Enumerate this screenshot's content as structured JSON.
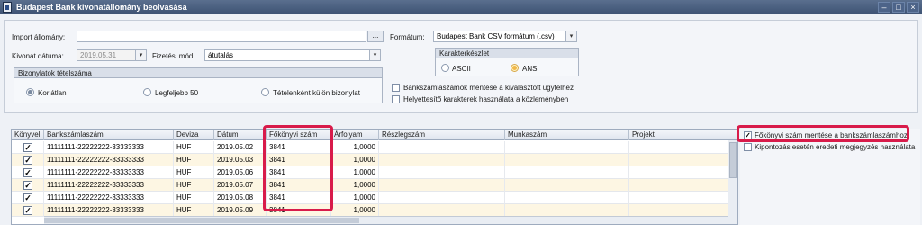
{
  "window": {
    "title": "Budapest Bank kivonatállomány beolvasása"
  },
  "form": {
    "import_label": "Import állomány:",
    "import_value": "",
    "browse_label": "...",
    "date_label": "Kivonat dátuma:",
    "date_value": "2019.05.31",
    "payment_label": "Fizetési mód:",
    "payment_value": "átutalás",
    "format_label": "Formátum:",
    "format_value": "Budapest Bank CSV formátum (.csv)"
  },
  "count_group": {
    "title": "Bizonylatok tételszáma",
    "options": [
      "Korlátlan",
      "Legfeljebb 50",
      "Tételenként külön bizonylat"
    ],
    "selected": 0
  },
  "charset_group": {
    "title": "Karakterkészlet",
    "options": [
      "ASCII",
      "ANSI"
    ],
    "selected": 1
  },
  "checks": {
    "save_accounts": "Bankszámlaszámok mentése a kiválasztott ügyfélhez",
    "replacement_chars": "Helyettesítő karakterek használata a közleményben"
  },
  "grid": {
    "columns": [
      "Könyvel",
      "Bankszámlaszám",
      "Deviza",
      "Dátum",
      "Főkönyvi szám",
      "Árfolyam",
      "Részlegszám",
      "Munkaszám",
      "Projekt"
    ],
    "rows": [
      {
        "checked": true,
        "account": "11111111-22222222-33333333",
        "currency": "HUF",
        "date": "2019.05.02",
        "ledger": "3841",
        "rate": "1,0000"
      },
      {
        "checked": true,
        "account": "11111111-22222222-33333333",
        "currency": "HUF",
        "date": "2019.05.03",
        "ledger": "3841",
        "rate": "1,0000"
      },
      {
        "checked": true,
        "account": "11111111-22222222-33333333",
        "currency": "HUF",
        "date": "2019.05.06",
        "ledger": "3841",
        "rate": "1,0000"
      },
      {
        "checked": true,
        "account": "11111111-22222222-33333333",
        "currency": "HUF",
        "date": "2019.05.07",
        "ledger": "3841",
        "rate": "1,0000"
      },
      {
        "checked": true,
        "account": "11111111-22222222-33333333",
        "currency": "HUF",
        "date": "2019.05.08",
        "ledger": "3841",
        "rate": "1,0000"
      },
      {
        "checked": true,
        "account": "11111111-22222222-33333333",
        "currency": "HUF",
        "date": "2019.05.09",
        "ledger": "3841",
        "rate": "1,0000"
      }
    ]
  },
  "side_options": {
    "save_ledger": {
      "label": "Főkönyvi szám mentése a bankszámlaszámhoz",
      "checked": true
    },
    "central_note": {
      "label": "Kipontozás esetén eredeti megjegyzés használata",
      "checked": false
    }
  },
  "colors": {
    "highlight": "#d81b4a",
    "alt_row": "#fdf6e3",
    "titlebar": "#4a5f80"
  }
}
